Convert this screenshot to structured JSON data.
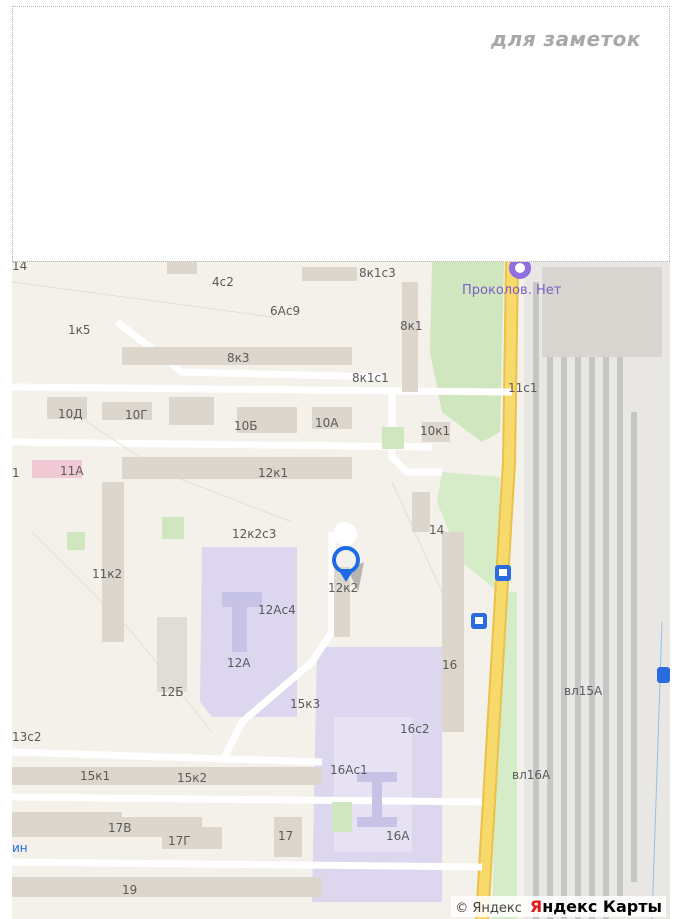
{
  "notes": {
    "label": "для заметок"
  },
  "map": {
    "poi": "Проколов. Нет",
    "labels": {
      "l_8k1c3": "8к1с3",
      "l_4c2": "4с2",
      "l_6Ac9": "6Ас9",
      "l_1k5": "1к5",
      "l_8k1": "8к1",
      "l_8k3": "8к3",
      "l_8k1c1": "8к1с1",
      "l_11c1": "11с1",
      "l_10D": "10Д",
      "l_10G": "10Г",
      "l_10B": "10Б",
      "l_10A": "10А",
      "l_10k1": "10к1",
      "l_11A": "11А",
      "l_12k1": "12к1",
      "l_14": "14",
      "l_12k2c3": "12к2с3",
      "l_11k2": "11к2",
      "l_12k2": "12к2",
      "l_12Ac4": "12Ас4",
      "l_12A": "12А",
      "l_12B": "12Б",
      "l_16": "16",
      "l_vl15A": "вл15А",
      "l_15k3": "15к3",
      "l_16c2": "16с2",
      "l_13c2": "13с2",
      "l_15k1": "15к1",
      "l_15k2": "15к2",
      "l_16Ac1": "16Ас1",
      "l_vl16A": "вл16А",
      "l_17V": "17В",
      "l_17G": "17Г",
      "l_17": "17",
      "l_16A": "16А",
      "l_19": "19",
      "l_1": "1",
      "l_14top": "14",
      "l_in": "ин"
    },
    "copyright": "© Яндекс",
    "brand_red": "Я",
    "brand_black": "ндекс Карты",
    "colors": {
      "road_major": "#f6cf5b",
      "park": "#cfe6bf",
      "school": "#dcd7ef",
      "building": "#ddd6cc",
      "rail": "#cccccc",
      "pin": "#1e6be6"
    }
  }
}
